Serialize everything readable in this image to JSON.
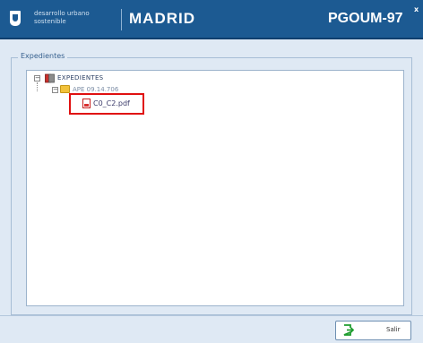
{
  "header": {
    "logo_subtitle": "desarrollo urbano sostenible",
    "city": "MADRID",
    "plan_name": "PGOUM-97",
    "close_glyph": "x"
  },
  "panel": {
    "legend": "Expedientes"
  },
  "tree": {
    "root_label": "EXPEDIENTES",
    "folder_label": "APE 09.14.706",
    "file_label": "C0_C2.pdf",
    "root_icon": "book-icon",
    "folder_icon": "folder-icon",
    "file_icon": "pdf-icon"
  },
  "footer": {
    "exit_label": "Salir",
    "exit_icon": "exit-door-icon"
  },
  "colors": {
    "header_bg": "#1c5a92",
    "panel_bg": "#dfe9f4",
    "highlight": "#e01010",
    "exit_icon": "#1f9d2f"
  }
}
